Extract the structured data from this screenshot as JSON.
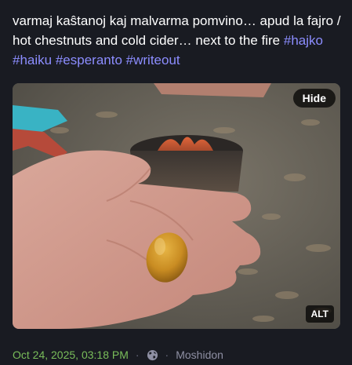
{
  "status": {
    "text_plain": "varmaj kaŝtanoj kaj malvarma pomvino… apud la fajro / hot chestnuts and cold cider… next to the fire ",
    "hashtags": [
      "#hajko",
      "#haiku",
      "#esperanto",
      "#writeout"
    ]
  },
  "media": {
    "hide_label": "Hide",
    "alt_label": "ALT"
  },
  "meta": {
    "timestamp": "Oct 24, 2025, 03:18 PM",
    "separator": "·",
    "visibility_icon": "globe-icon",
    "app": "Moshidon"
  },
  "colors": {
    "background": "#191b22",
    "hashtag": "#8c8dff",
    "timestamp": "#79bd5a",
    "meta_text": "#8e8fa3"
  }
}
